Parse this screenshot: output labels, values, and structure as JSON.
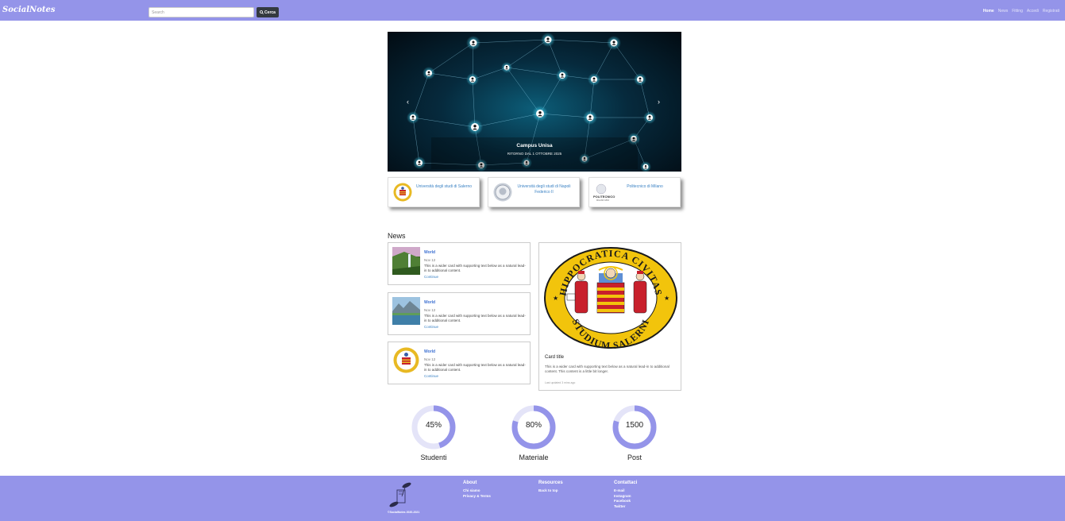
{
  "navbar": {
    "brand": "SocialNotes",
    "search_placeholder": "Search",
    "search_button": "Cerca",
    "links": [
      "Home",
      "News",
      "Fitting",
      "Accedi",
      "Registrati"
    ]
  },
  "carousel": {
    "title": "Campus Unisa",
    "subtitle": "RITORNO DAL 1 OTTOBRE 2025"
  },
  "universities": [
    {
      "name": "Università degli studi di Salerno"
    },
    {
      "name": "Università degli studi di Napoli Federico II"
    },
    {
      "name": "Politecnico di Milano",
      "logo_text": "POLITECNICO",
      "logo_subtext": "MILANO 1863"
    }
  ],
  "news": {
    "heading": "News",
    "items": [
      {
        "category": "World",
        "date": "Nov 12",
        "text": "This is a wider card with supporting text below as a natural lead-in to additional content.",
        "link": "Continue"
      },
      {
        "category": "World",
        "date": "Nov 12",
        "text": "This is a wider card with supporting text below as a natural lead-in to additional content.",
        "link": "Continue"
      },
      {
        "category": "World",
        "date": "Nov 12",
        "text": "This is a wider card with supporting text below as a natural lead-in to additional content.",
        "link": "Continue"
      }
    ],
    "feature": {
      "seal_top": "HIPPOCRATICA CIVITAS",
      "seal_bottom": "STUDIUM SALERNI",
      "title": "Card title",
      "text": "This is a wider card with supporting text below as a natural lead-in to additional content. This content is a little bit longer.",
      "updated": "Last updated 3 mins ago"
    }
  },
  "stats": [
    {
      "value": "45%",
      "label": "Studenti",
      "fraction": 0.45
    },
    {
      "value": "80%",
      "label": "Materiale",
      "fraction": 0.8
    },
    {
      "value": "1500",
      "label": "Post",
      "fraction": 0.8
    }
  ],
  "footer": {
    "copyright": "©SocialNotes 2020-2021",
    "about": {
      "title": "About",
      "links": [
        "Chi siamo",
        "Privacy & Terms"
      ]
    },
    "resources": {
      "title": "Resources",
      "links": [
        "Back to top"
      ]
    },
    "contact": {
      "title": "Contattaci",
      "links": [
        "E-mail",
        "Instagram",
        "Facebook",
        "Twitter"
      ]
    }
  },
  "colors": {
    "accent": "#9494e9",
    "ring_track": "#e4e4f8",
    "link": "#3b82c4"
  }
}
